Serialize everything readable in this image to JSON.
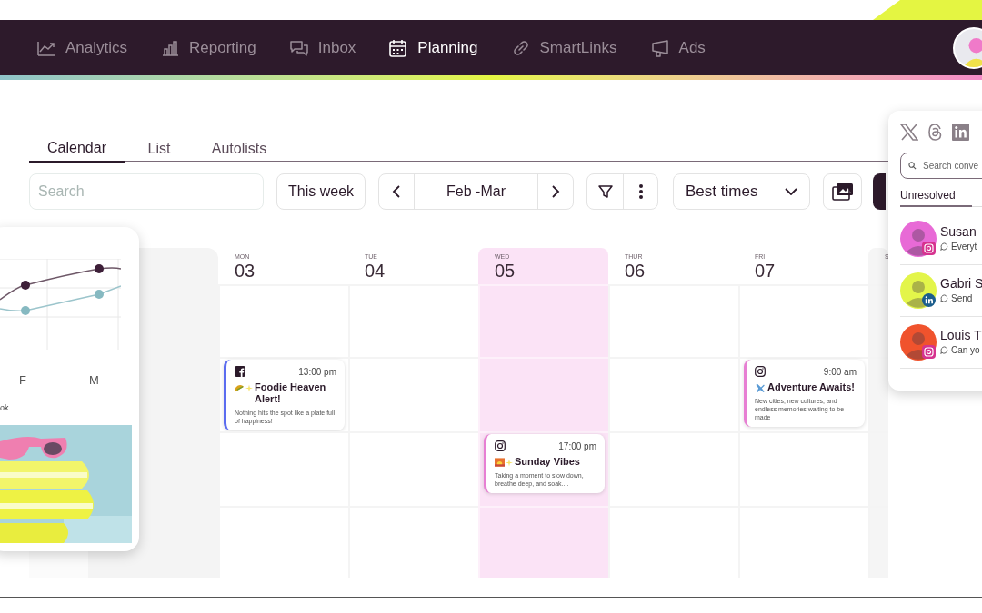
{
  "nav": {
    "items": [
      {
        "label": "Analytics",
        "selected": false
      },
      {
        "label": "Reporting",
        "selected": false
      },
      {
        "label": "Inbox",
        "selected": false
      },
      {
        "label": "Planning",
        "selected": true
      },
      {
        "label": "SmartLinks",
        "selected": false
      },
      {
        "label": "Ads",
        "selected": false
      }
    ]
  },
  "tabs": [
    {
      "label": "Calendar",
      "selected": true
    },
    {
      "label": "List",
      "selected": false
    },
    {
      "label": "Autolists",
      "selected": false
    }
  ],
  "toolbar": {
    "search": {
      "placeholder": "Search"
    },
    "period": "This week",
    "date_range": "Feb -Mar",
    "best_times": "Best times"
  },
  "calendar": {
    "days": [
      {
        "weekday": "MON",
        "day": "03",
        "selected": false
      },
      {
        "weekday": "TUE",
        "day": "04",
        "selected": false
      },
      {
        "weekday": "WED",
        "day": "05",
        "selected": true
      },
      {
        "weekday": "THUR",
        "day": "06",
        "selected": false
      },
      {
        "weekday": "FRI",
        "day": "07",
        "selected": false
      },
      {
        "weekday": "S",
        "selected": false
      }
    ],
    "posts": [
      {
        "kind": "facebook",
        "time": "13:00 pm",
        "title": "Foodie Heaven Alert!",
        "text": "Nothing hits the spot like a plate full of happiness!",
        "color": "#5b6cf0"
      },
      {
        "kind": "instagram",
        "time": "9:00 am",
        "title": "Adventure Awaits!",
        "text": "New cities, new cultures, and endless memories waiting to be made",
        "color": "#e77fd3"
      },
      {
        "kind": "instagram",
        "time": "17:00 pm",
        "title": "Sunday Vibes",
        "text": "Taking a moment to slow down, breathe deep, and soak....",
        "color": "#e77fd3"
      }
    ]
  },
  "stats_card": {
    "x_labels": [
      "F",
      "M"
    ],
    "legend": "ok",
    "picture": {
      "kind": "picture"
    }
  },
  "inbox_panel": {
    "search": {
      "placeholder": "Search conve"
    },
    "tab": {
      "label": "Unresolved",
      "selected": true
    },
    "conversations": [
      {
        "name": "Susan",
        "preview": "Everyt",
        "color": "#e86ad6",
        "kind": "instagram"
      },
      {
        "name": "Gabri S",
        "preview": "Send",
        "color": "#e3f54a",
        "kind": "linkedin"
      },
      {
        "name": "Louis T",
        "preview": "Can yo",
        "color": "#f0532d",
        "kind": "instagram"
      }
    ]
  }
}
